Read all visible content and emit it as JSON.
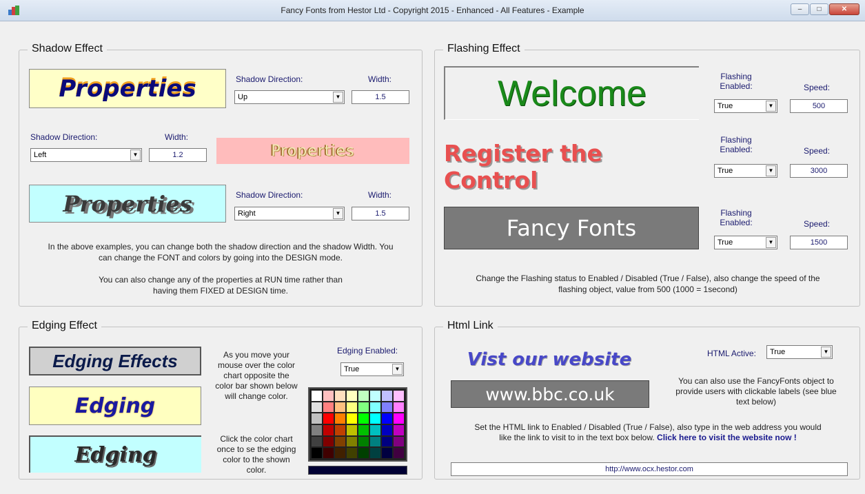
{
  "window": {
    "title": "Fancy Fonts from Hestor Ltd - Copyright 2015 - Enhanced - All Features - Example",
    "minimize": "–",
    "maximize": "□",
    "close": "✕"
  },
  "shadow": {
    "title": "Shadow Effect",
    "box1_text": "Properties",
    "box2_text": "Properties",
    "box3_text": "Properties",
    "dir_label": "Shadow Direction:",
    "width_label": "Width:",
    "dir1": "Up",
    "width1": "1.5",
    "dir2": "Left",
    "width2": "1.2",
    "dir3": "Right",
    "width3": "1.5",
    "para1_line1": "In the above examples, you can change both the shadow direction and the shadow Width. You",
    "para1_line2": "can change the FONT and colors by going into the DESIGN mode.",
    "para2_line1": "You can also change any of the properties at RUN time rather than",
    "para2_line2": "having them FIXED at DESIGN time."
  },
  "flashing": {
    "title": "Flashing Effect",
    "box1_text": "Welcome",
    "box2_text": "Register the Control",
    "box3_text": "Fancy Fonts",
    "enabled_label_1": "Flashing",
    "enabled_label_2": "Enabled:",
    "speed_label": "Speed:",
    "enabled1": "True",
    "speed1": "500",
    "enabled2": "True",
    "speed2": "3000",
    "enabled3": "True",
    "speed3": "1500",
    "note_line1": "Change the Flashing status to Enabled / Disabled (True / False), also change the speed of the",
    "note_line2": "flashing object, value from 500 (1000 = 1second)"
  },
  "edging": {
    "title": "Edging Effect",
    "box1_text": "Edging Effects",
    "box2_text": "Edging",
    "box3_text": "Edging",
    "para1": [
      "As you move your",
      "mouse over the color",
      "chart opposite the",
      "color bar shown below",
      "will change color."
    ],
    "para2": [
      "Click the color chart",
      "once to se the edging",
      "color to the shown",
      "color."
    ],
    "enabled_label": "Edging Enabled:",
    "enabled_value": "True",
    "palette": [
      "#ffffff",
      "#ffc0c0",
      "#ffe0c0",
      "#ffffc0",
      "#c0ffc0",
      "#c0ffff",
      "#c0c0ff",
      "#ffc0ff",
      "#e0e0e0",
      "#ff8080",
      "#ffc080",
      "#ffff80",
      "#80ff80",
      "#80ffff",
      "#8080ff",
      "#ff80ff",
      "#c0c0c0",
      "#ff0000",
      "#ff8000",
      "#ffff00",
      "#00ff00",
      "#00ffff",
      "#0000ff",
      "#ff00ff",
      "#808080",
      "#c00000",
      "#c04000",
      "#c0c000",
      "#00c000",
      "#00c0c0",
      "#0000c0",
      "#c000c0",
      "#404040",
      "#800000",
      "#804000",
      "#808000",
      "#008000",
      "#008080",
      "#000080",
      "#800080",
      "#000000",
      "#400000",
      "#402000",
      "#404000",
      "#004000",
      "#004040",
      "#000040",
      "#400040"
    ],
    "selected_color": "#000033"
  },
  "html": {
    "title": "Html Link",
    "box1_text": "Vist our website",
    "box2_text": "www.bbc.co.uk",
    "active_label": "HTML Active:",
    "active_value": "True",
    "side_note": [
      "You can also use the FancyFonts object to",
      "provide users with clickable labels (see blue",
      "text below)"
    ],
    "para_line1": "Set the HTML link to Enabled / Disabled (True / False), also type in the web address you would",
    "para_line2": "like the link to visit to in the text box below.",
    "link_text": "Click here to visit the website now !",
    "url": "http://www.ocx.hestor.com"
  }
}
